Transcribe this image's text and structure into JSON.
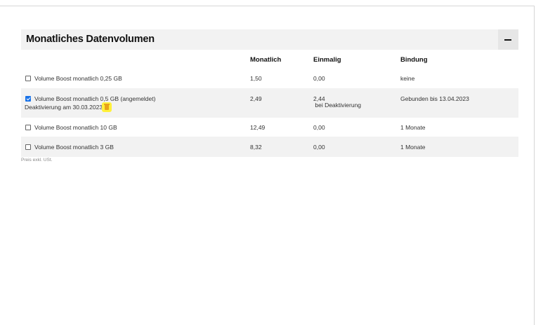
{
  "panel": {
    "title": "Monatliches Datenvolumen",
    "collapse_icon": "minus-icon"
  },
  "columns": {
    "monthly": "Monatlich",
    "once": "Einmalig",
    "binding": "Bindung"
  },
  "rows": [
    {
      "label": "Volume Boost monatlich 0,25 GB",
      "checked": false,
      "monthly": "1,50",
      "once": "0,00",
      "once_note": "",
      "binding": "keine",
      "sub": ""
    },
    {
      "label": "Volume Boost monatlich 0,5 GB (angemeldet)",
      "checked": true,
      "monthly": "2,49",
      "once": "2,44",
      "once_note": " bei Deaktivierung",
      "binding": "Gebunden bis 13.04.2023",
      "sub": "Deaktivierung am 30.03.2023",
      "sub_icon": "trash-icon"
    },
    {
      "label": "Volume Boost monatlich 10 GB",
      "checked": false,
      "monthly": "12,49",
      "once": "0,00",
      "once_note": "",
      "binding": "1 Monate",
      "sub": ""
    },
    {
      "label": "Volume Boost monatlich 3 GB",
      "checked": false,
      "monthly": "8,32",
      "once": "0,00",
      "once_note": "",
      "binding": "1 Monate",
      "sub": ""
    }
  ],
  "footnote": "Preis exkl. USt.",
  "colors": {
    "accent": "#1a73e8",
    "highlight": "#fff13a",
    "header_bg": "#f2f2f2"
  }
}
